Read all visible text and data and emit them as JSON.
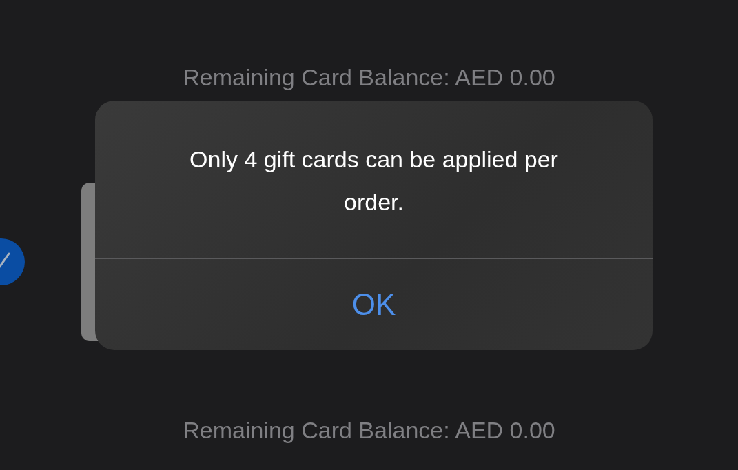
{
  "top_balance": "Remaining Card Balance: AED 0.00",
  "card_row": {
    "selected": true
  },
  "bottom_balance": "Remaining Card Balance: AED 0.00",
  "alert": {
    "message": "Only 4 gift cards can be applied per order.",
    "buttons": [
      "OK"
    ]
  }
}
